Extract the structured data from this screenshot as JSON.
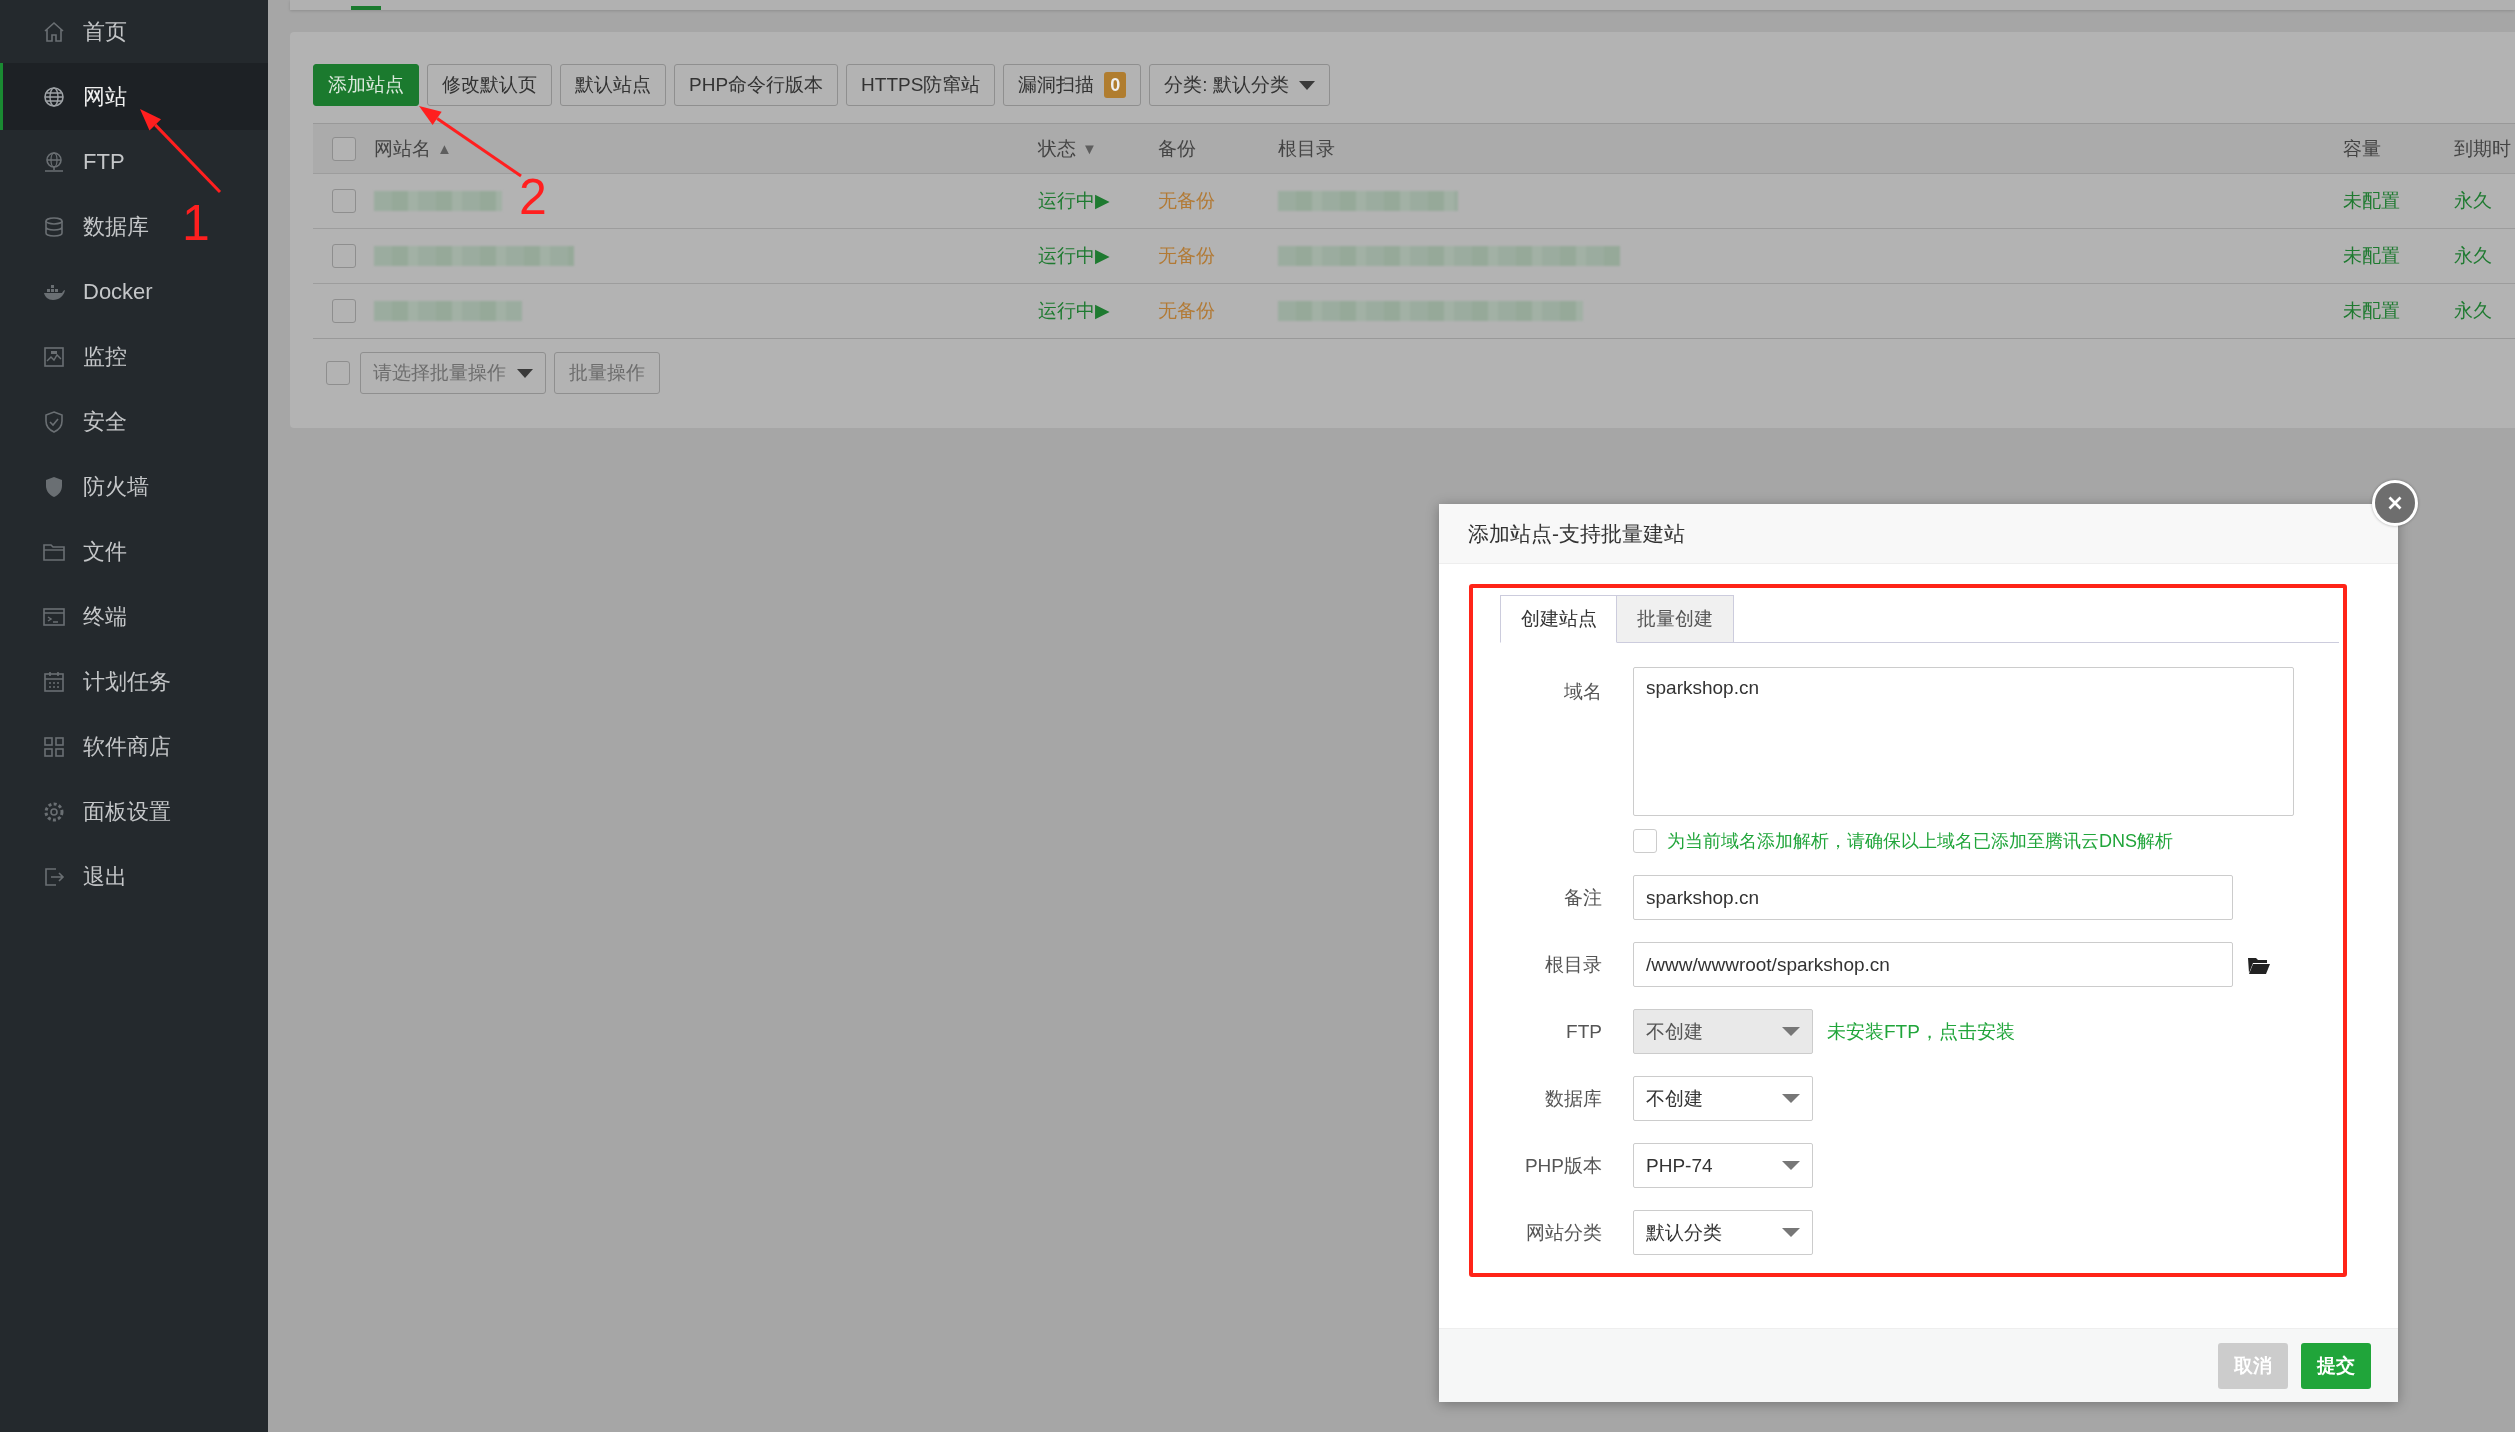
{
  "sidebar": {
    "items": [
      {
        "label": "首页",
        "selected": false
      },
      {
        "label": "网站",
        "selected": true
      },
      {
        "label": "FTP",
        "selected": false
      },
      {
        "label": "数据库",
        "selected": false
      },
      {
        "label": "Docker",
        "selected": false
      },
      {
        "label": "监控",
        "selected": false
      },
      {
        "label": "安全",
        "selected": false
      },
      {
        "label": "防火墙",
        "selected": false
      },
      {
        "label": "文件",
        "selected": false
      },
      {
        "label": "终端",
        "selected": false
      },
      {
        "label": "计划任务",
        "selected": false
      },
      {
        "label": "软件商店",
        "selected": false
      },
      {
        "label": "面板设置",
        "selected": false
      },
      {
        "label": "退出",
        "selected": false
      }
    ]
  },
  "toolbar": {
    "buttons": [
      {
        "kind": "primary",
        "label": "添加站点"
      },
      {
        "kind": "plain",
        "label": "修改默认页"
      },
      {
        "kind": "plain",
        "label": "默认站点"
      },
      {
        "kind": "plain",
        "label": "PHP命令行版本"
      },
      {
        "kind": "plain",
        "label": "HTTPS防窜站"
      },
      {
        "kind": "badge",
        "label": "漏洞扫描",
        "badge": "0"
      },
      {
        "kind": "dropdown",
        "label": "分类: 默认分类"
      }
    ]
  },
  "table": {
    "select_all": {
      "checked": false
    },
    "columns": [
      {
        "label": "网站名",
        "sort_mark": "▲"
      },
      {
        "label": "状态",
        "sort_mark": "▼"
      },
      {
        "label": "备份"
      },
      {
        "label": "根目录"
      },
      {
        "label": "容量"
      },
      {
        "label": "到期时"
      }
    ],
    "rows": [
      {
        "checked": false,
        "name_blurred": true,
        "status": "运行中▶",
        "backup": "无备份",
        "root_blurred": true,
        "capacity": "未配置",
        "expiry": "永久"
      },
      {
        "checked": false,
        "name_blurred": true,
        "status": "运行中▶",
        "backup": "无备份",
        "root_blurred": true,
        "capacity": "未配置",
        "expiry": "永久"
      },
      {
        "checked": false,
        "name_blurred": true,
        "status": "运行中▶",
        "backup": "无备份",
        "root_blurred": true,
        "capacity": "未配置",
        "expiry": "永久"
      }
    ],
    "bulk": {
      "checked": false,
      "select": "请选择批量操作",
      "button": "批量操作"
    }
  },
  "dialog": {
    "title": "添加站点-支持批量建站",
    "tabs": [
      {
        "label": "创建站点",
        "selected": true
      },
      {
        "label": "批量创建",
        "selected": false
      }
    ],
    "fields": [
      {
        "kind": "textarea",
        "label": "域名",
        "value": "sparkshop.cn"
      },
      {
        "kind": "checkbox",
        "checked": false,
        "text": "为当前域名添加解析，请确保以上域名已添加至腾讯云DNS解析"
      },
      {
        "kind": "input",
        "label": "备注",
        "value": "sparkshop.cn"
      },
      {
        "kind": "path",
        "label": "根目录",
        "value": "/www/wwwroot/sparkshop.cn"
      },
      {
        "kind": "select",
        "label": "FTP",
        "value": "不创建",
        "disabled": true,
        "link": "未安装FTP，点击安装"
      },
      {
        "kind": "select",
        "label": "数据库",
        "value": "不创建",
        "disabled": false
      },
      {
        "kind": "select",
        "label": "PHP版本",
        "value": "PHP-74",
        "disabled": false
      },
      {
        "kind": "select",
        "label": "网站分类",
        "value": "默认分类",
        "disabled": false
      }
    ],
    "buttons": [
      {
        "kind": "cancel",
        "label": "取消"
      },
      {
        "kind": "submit",
        "label": "提交"
      }
    ]
  },
  "annotations": [
    {
      "label": "1"
    },
    {
      "label": "2"
    }
  ]
}
